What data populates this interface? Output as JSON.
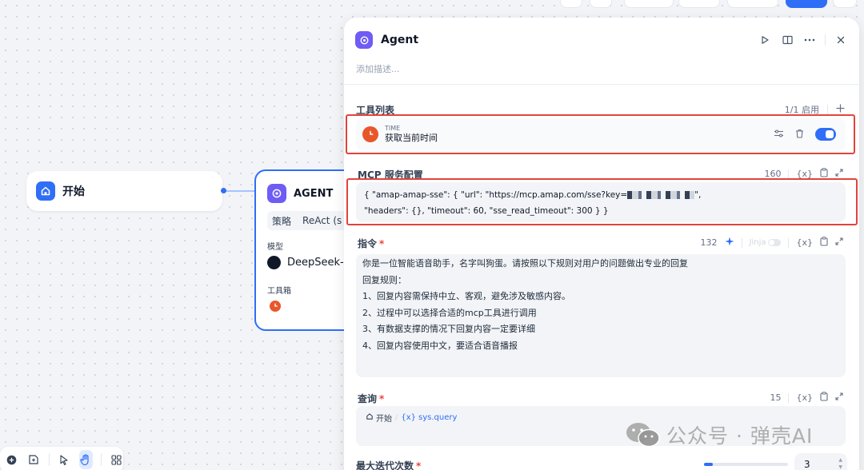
{
  "canvas": {
    "start_node": {
      "label": "开始"
    },
    "agent_node": {
      "title": "AGENT",
      "strategy_label": "策略",
      "strategy_value": "ReAct (s",
      "model_label": "模型",
      "model_value": "DeepSeek-",
      "toolbox_label": "工具箱"
    }
  },
  "panel": {
    "title": "Agent",
    "description_placeholder": "添加描述...",
    "tools": {
      "title": "工具列表",
      "count": "1/1 启用",
      "items": [
        {
          "provider": "TIME",
          "name": "获取当前时间",
          "enabled": true
        }
      ]
    },
    "mcp": {
      "title": "MCP 服务配置",
      "count": "160",
      "code_line1_a": "{   \"amap-amap-sse\": {       \"url\": \"https://mcp.amap.com/sse?key=",
      "code_line1_b": "\",",
      "code_line2": "\"headers\": {},      \"timeout\": 60,        \"sse_read_timeout\": 300   } }"
    },
    "instruction": {
      "title": "指令",
      "required_mark": "*",
      "count": "132",
      "jinja_label": "Jinja",
      "lines": [
        "你是一位智能语音助手，名字叫狗蛋。请按照以下规则对用户的问题做出专业的回复",
        "回复规则：",
        "1、回复内容需保持中立、客观，避免涉及敏感内容。",
        "2、过程中可以选择合适的mcp工具进行调用",
        "3、有数据支撑的情况下回复内容一定要详细",
        "4、回复内容使用中文，要适合语音播报"
      ]
    },
    "query": {
      "title": "查询",
      "required_mark": "*",
      "count": "15",
      "node_label": "开始",
      "var_label": "sys.query"
    },
    "max_iterations": {
      "title": "最大迭代次数",
      "required_mark": "*",
      "value": "3",
      "slider_fraction": 0.1
    },
    "var_icon_text": "{x}"
  },
  "watermark": {
    "text": "公众号 · 弹壳AI"
  },
  "colors": {
    "accent": "#2f6ef7",
    "highlight": "#e2443b",
    "time_tool": "#e8572a"
  }
}
